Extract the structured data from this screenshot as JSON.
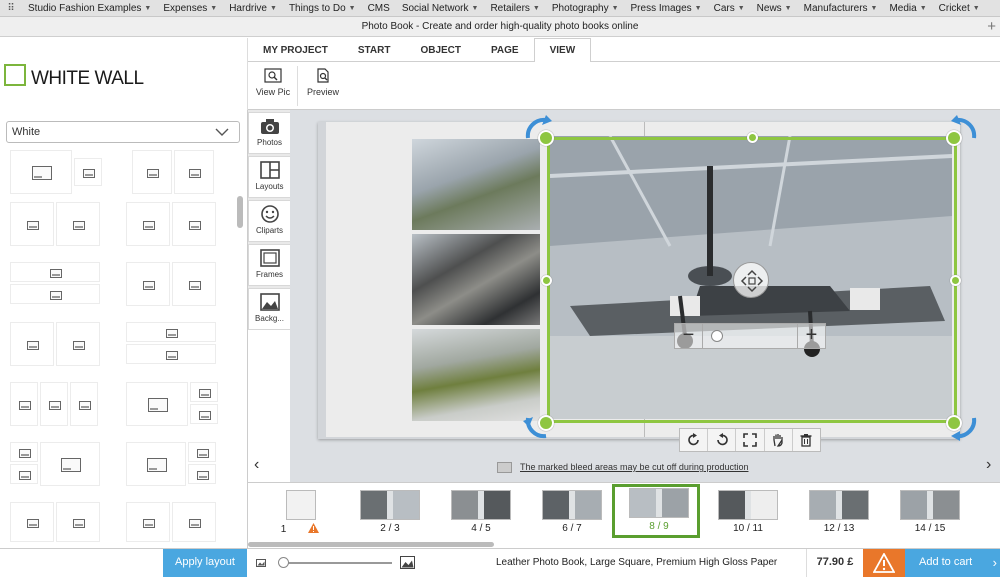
{
  "bookmarks": [
    {
      "label": "Studio Fashion Examples",
      "dropdown": true
    },
    {
      "label": "Expenses",
      "dropdown": true
    },
    {
      "label": "Hardrive",
      "dropdown": true
    },
    {
      "label": "Things to Do",
      "dropdown": true
    },
    {
      "label": "CMS",
      "dropdown": false
    },
    {
      "label": "Social Network",
      "dropdown": true
    },
    {
      "label": "Retailers",
      "dropdown": true
    },
    {
      "label": "Photography",
      "dropdown": true
    },
    {
      "label": "Press Images",
      "dropdown": true
    },
    {
      "label": "Cars",
      "dropdown": true
    },
    {
      "label": "News",
      "dropdown": true
    },
    {
      "label": "Manufacturers",
      "dropdown": true
    },
    {
      "label": "Media",
      "dropdown": true
    },
    {
      "label": "Cricket",
      "dropdown": true
    }
  ],
  "window": {
    "title": "Photo Book - Create and order high-quality photo books online"
  },
  "brand": {
    "logo_text": "WHITE WALL",
    "accent_color": "#8ec641"
  },
  "menu_tabs": [
    {
      "label": "MY PROJECT",
      "active": false
    },
    {
      "label": "START",
      "active": false
    },
    {
      "label": "OBJECT",
      "active": false
    },
    {
      "label": "PAGE",
      "active": false
    },
    {
      "label": "VIEW",
      "active": true
    }
  ],
  "ribbon": {
    "view_pic_label": "View Pic",
    "preview_label": "Preview"
  },
  "sidebar": {
    "color_select_value": "White"
  },
  "vertical_tools": [
    {
      "label": "Photos",
      "icon": "camera-icon"
    },
    {
      "label": "Layouts",
      "icon": "layout-icon"
    },
    {
      "label": "Cliparts",
      "icon": "smiley-icon"
    },
    {
      "label": "Frames",
      "icon": "frame-icon"
    },
    {
      "label": "Backg...",
      "icon": "background-icon"
    }
  ],
  "canvas": {
    "bleed_notice": "The marked bleed areas may be cut off during production"
  },
  "pages": [
    {
      "label": "1",
      "warning": true
    },
    {
      "label": "2 / 3",
      "warning": false
    },
    {
      "label": "4 / 5",
      "warning": false
    },
    {
      "label": "6 / 7",
      "warning": false
    },
    {
      "label": "8 / 9",
      "warning": false,
      "selected": true
    },
    {
      "label": "10 / 11",
      "warning": false
    },
    {
      "label": "12 / 13",
      "warning": false
    },
    {
      "label": "14 / 15",
      "warning": false
    }
  ],
  "footer": {
    "apply_layout_label": "Apply layout",
    "product_name": "Leather Photo Book, Large Square, Premium High Gloss Paper",
    "price": "77.90 £",
    "add_to_cart_label": "Add to cart"
  }
}
